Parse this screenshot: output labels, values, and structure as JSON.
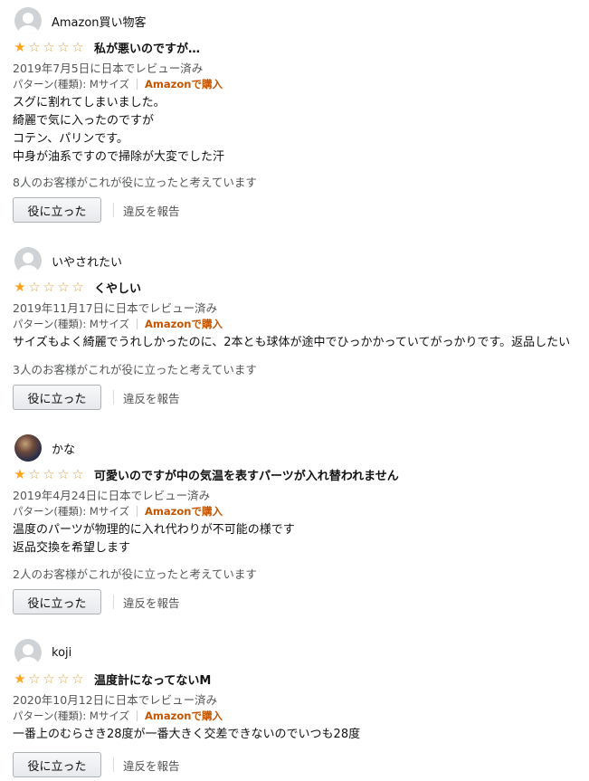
{
  "reviews": [
    {
      "reviewer": "Amazon買い物客",
      "avatar": "default-avatar",
      "rating": 1,
      "title": "私が悪いのですが…",
      "date": "2019年7月5日に日本でレビュー済み",
      "variant": "パターン(種類): Mサイズ",
      "verified": "Amazonで購入",
      "body": [
        "スグに割れてしまいました。",
        "綺麗で気に入ったのですが",
        "コテン、パリンです。",
        "中身が油系ですので掃除が大変でした汗"
      ],
      "helpful": "8人のお客様がこれが役に立ったと考えています",
      "helpful_button": "役に立った",
      "report": "違反を報告"
    },
    {
      "reviewer": "いやされたい",
      "avatar": "default-avatar",
      "rating": 1,
      "title": "くやしい",
      "date": "2019年11月17日に日本でレビュー済み",
      "variant": "パターン(種類): Mサイズ",
      "verified": "Amazonで購入",
      "body": [
        "サイズもよく綺麗でうれしかったのに、2本とも球体が途中でひっかかっていてがっかりです。返品したい"
      ],
      "helpful": "3人のお客様がこれが役に立ったと考えています",
      "helpful_button": "役に立った",
      "report": "違反を報告"
    },
    {
      "reviewer": "かな",
      "avatar": "photo-avatar",
      "rating": 1,
      "title": "可愛いのですが中の気温を表すパーツが入れ替われません",
      "date": "2019年4月24日に日本でレビュー済み",
      "variant": "パターン(種類): Mサイズ",
      "verified": "Amazonで購入",
      "body": [
        "温度のパーツが物理的に入れ代わりが不可能の様です",
        "返品交換を希望します"
      ],
      "helpful": "2人のお客様がこれが役に立ったと考えています",
      "helpful_button": "役に立った",
      "report": "違反を報告"
    },
    {
      "reviewer": "koji",
      "avatar": "default-avatar",
      "rating": 1,
      "title": "温度計になってないM",
      "date": "2020年10月12日に日本でレビュー済み",
      "variant": "パターン(種類): Mサイズ",
      "verified": "Amazonで購入",
      "body": [
        "一番上のむらさき28度が一番大きく交差できないのでいつも28度"
      ],
      "helpful": "",
      "helpful_button": "役に立った",
      "report": "違反を報告"
    }
  ],
  "colors": {
    "star": "#ffa41c",
    "verified": "#c45500",
    "muted": "#555555"
  }
}
